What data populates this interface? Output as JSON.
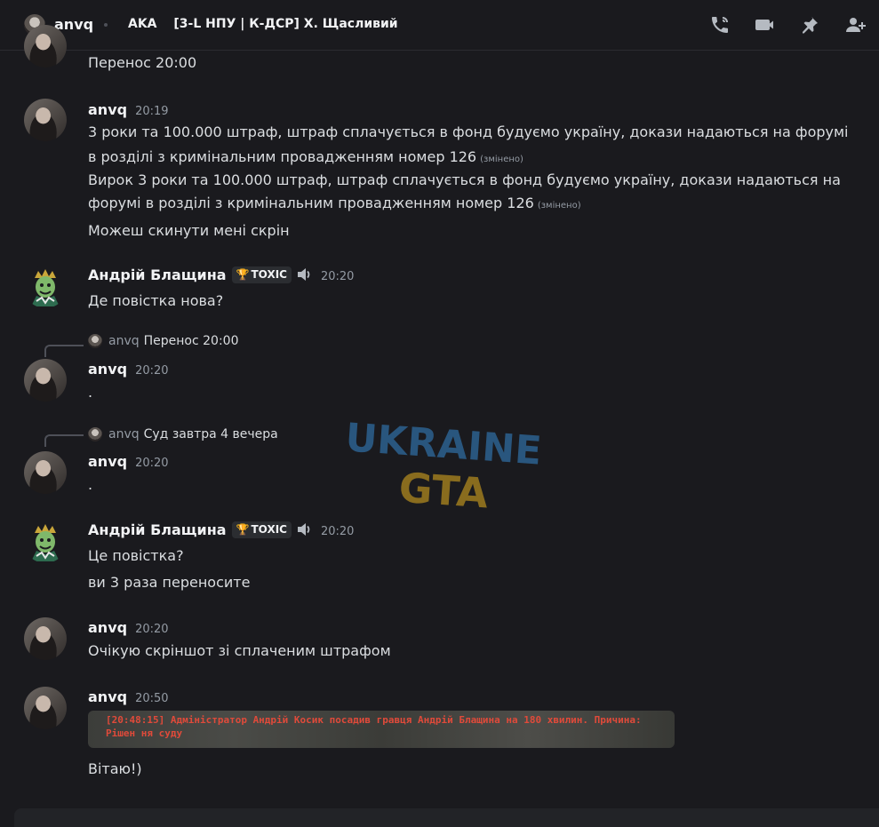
{
  "header": {
    "username": "anvq",
    "channel_tag": "AKA",
    "channel_name": "[3-L НПУ | К-ДСР] Х. Щасливий"
  },
  "icons": {
    "call": "phone-call-icon",
    "video": "video-camera-icon",
    "pin": "pin-icon",
    "add_member": "add-member-icon",
    "volume": "speaker-icon",
    "trophy": "trophy-icon"
  },
  "colors": {
    "background": "#1a1a1e",
    "text": "#dbdee1",
    "muted": "#949ba4",
    "badge_green": "#3ba55d",
    "screenshot_red": "#e04a3a"
  },
  "messages": [
    {
      "text": "Перенос 20:00"
    },
    {
      "author": "anvq",
      "time": "20:19",
      "lines": [
        {
          "text": "3 роки та 100.000 штраф, штраф сплачується в фонд будуємо україну, докази надаються на форумі"
        },
        {
          "text": "в розділі з кримінальним провадженням номер 126",
          "edited": "(змінено)"
        },
        {
          "text": "Вирок 3 роки та 100.000 штраф, штраф сплачується в фонд будуємо україну, докази надаються на"
        },
        {
          "text": "форумі в розділі з кримінальним провадженням номер 126",
          "edited": "(змінено)"
        },
        {
          "text": "Можеш скинути мені скрін"
        }
      ]
    },
    {
      "author": "Андрій Блащина",
      "badge": "TOXIC",
      "time": "20:20",
      "lines": [
        {
          "text": "Де повістка нова?"
        }
      ]
    },
    {
      "reply": {
        "author": "anvq",
        "text": "Перенос 20:00"
      },
      "author": "anvq",
      "time": "20:20",
      "lines": [
        {
          "text": "."
        }
      ]
    },
    {
      "reply": {
        "author": "anvq",
        "text": "Суд завтра 4 вечера"
      },
      "author": "anvq",
      "time": "20:20",
      "lines": [
        {
          "text": "."
        }
      ]
    },
    {
      "author": "Андрій Блащина",
      "badge": "TOXIC",
      "time": "20:20",
      "lines": [
        {
          "text": "Це повістка?"
        },
        {
          "text": "ви 3 раза переносите"
        }
      ]
    },
    {
      "author": "anvq",
      "time": "20:20",
      "lines": [
        {
          "text": "Очікую скріншот зі сплаченим штрафом"
        }
      ]
    },
    {
      "author": "anvq",
      "time": "20:50",
      "attachment_text": "[20:48:15] Адміністратор Андрій Косик посадив гравця Андрій Блащина на 180 хвилин. Причина: Рішен ня суду",
      "lines": [
        {
          "text": "Вітаю!)"
        }
      ]
    }
  ],
  "watermark": {
    "line1": "UKRAINE",
    "line2": "GTA"
  }
}
